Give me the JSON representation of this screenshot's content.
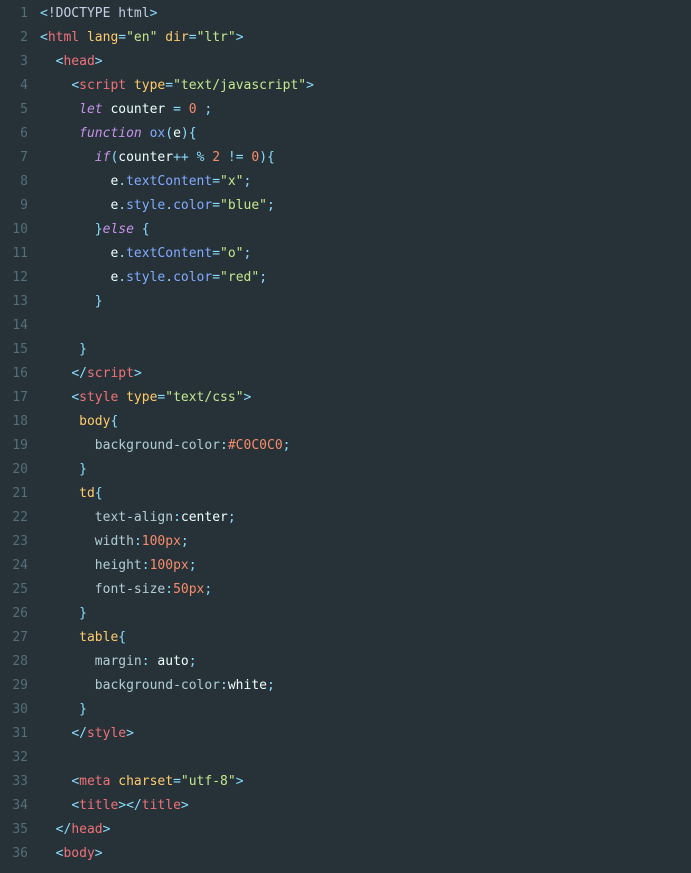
{
  "lines": [
    {
      "n": 1,
      "tokens": [
        [
          "<",
          "punc"
        ],
        [
          "!DOCTYPE html",
          "plain"
        ],
        [
          ">",
          "punc"
        ]
      ]
    },
    {
      "n": 2,
      "tokens": [
        [
          "<",
          "punc"
        ],
        [
          "html",
          "tag"
        ],
        [
          " ",
          "plain"
        ],
        [
          "lang",
          "attr"
        ],
        [
          "=",
          "op"
        ],
        [
          "\"en\"",
          "str"
        ],
        [
          " ",
          "plain"
        ],
        [
          "dir",
          "attr"
        ],
        [
          "=",
          "op"
        ],
        [
          "\"ltr\"",
          "str"
        ],
        [
          ">",
          "punc"
        ]
      ]
    },
    {
      "n": 3,
      "tokens": [
        [
          "  ",
          "plain"
        ],
        [
          "<",
          "punc"
        ],
        [
          "head",
          "tag"
        ],
        [
          ">",
          "punc"
        ]
      ]
    },
    {
      "n": 4,
      "tokens": [
        [
          "    ",
          "plain"
        ],
        [
          "<",
          "punc"
        ],
        [
          "script",
          "tag"
        ],
        [
          " ",
          "plain"
        ],
        [
          "type",
          "attr"
        ],
        [
          "=",
          "op"
        ],
        [
          "\"text/javascript\"",
          "str"
        ],
        [
          ">",
          "punc"
        ]
      ]
    },
    {
      "n": 5,
      "tokens": [
        [
          "     ",
          "plain"
        ],
        [
          "let",
          "keyword"
        ],
        [
          " ",
          "plain"
        ],
        [
          "counter",
          "var"
        ],
        [
          " ",
          "plain"
        ],
        [
          "=",
          "op"
        ],
        [
          " ",
          "plain"
        ],
        [
          "0",
          "num"
        ],
        [
          " ",
          "plain"
        ],
        [
          ";",
          "punc"
        ]
      ]
    },
    {
      "n": 6,
      "tokens": [
        [
          "     ",
          "plain"
        ],
        [
          "function",
          "keyword"
        ],
        [
          " ",
          "plain"
        ],
        [
          "ox",
          "prop"
        ],
        [
          "(",
          "punc"
        ],
        [
          "e",
          "var"
        ],
        [
          ")",
          "punc"
        ],
        [
          "{",
          "punc"
        ]
      ]
    },
    {
      "n": 7,
      "tokens": [
        [
          "       ",
          "plain"
        ],
        [
          "if",
          "keyword"
        ],
        [
          "(",
          "punc"
        ],
        [
          "counter",
          "var"
        ],
        [
          "++",
          "op"
        ],
        [
          " ",
          "plain"
        ],
        [
          "%",
          "op"
        ],
        [
          " ",
          "plain"
        ],
        [
          "2",
          "num"
        ],
        [
          " ",
          "plain"
        ],
        [
          "!=",
          "op"
        ],
        [
          " ",
          "plain"
        ],
        [
          "0",
          "num"
        ],
        [
          ")",
          "punc"
        ],
        [
          "{",
          "punc"
        ]
      ]
    },
    {
      "n": 8,
      "tokens": [
        [
          "         ",
          "plain"
        ],
        [
          "e",
          "var"
        ],
        [
          ".",
          "punc"
        ],
        [
          "textContent",
          "prop"
        ],
        [
          "=",
          "op"
        ],
        [
          "\"x\"",
          "str"
        ],
        [
          ";",
          "punc"
        ]
      ]
    },
    {
      "n": 9,
      "tokens": [
        [
          "         ",
          "plain"
        ],
        [
          "e",
          "var"
        ],
        [
          ".",
          "punc"
        ],
        [
          "style",
          "prop"
        ],
        [
          ".",
          "punc"
        ],
        [
          "color",
          "prop"
        ],
        [
          "=",
          "op"
        ],
        [
          "\"blue\"",
          "str"
        ],
        [
          ";",
          "punc"
        ]
      ]
    },
    {
      "n": 10,
      "tokens": [
        [
          "       ",
          "plain"
        ],
        [
          "}",
          "punc"
        ],
        [
          "else",
          "keyword"
        ],
        [
          " ",
          "plain"
        ],
        [
          "{",
          "punc"
        ]
      ]
    },
    {
      "n": 11,
      "tokens": [
        [
          "         ",
          "plain"
        ],
        [
          "e",
          "var"
        ],
        [
          ".",
          "punc"
        ],
        [
          "textContent",
          "prop"
        ],
        [
          "=",
          "op"
        ],
        [
          "\"o\"",
          "str"
        ],
        [
          ";",
          "punc"
        ]
      ]
    },
    {
      "n": 12,
      "tokens": [
        [
          "         ",
          "plain"
        ],
        [
          "e",
          "var"
        ],
        [
          ".",
          "punc"
        ],
        [
          "style",
          "prop"
        ],
        [
          ".",
          "punc"
        ],
        [
          "color",
          "prop"
        ],
        [
          "=",
          "op"
        ],
        [
          "\"red\"",
          "str"
        ],
        [
          ";",
          "punc"
        ]
      ]
    },
    {
      "n": 13,
      "tokens": [
        [
          "       ",
          "plain"
        ],
        [
          "}",
          "punc"
        ]
      ]
    },
    {
      "n": 14,
      "tokens": [
        [
          "",
          "plain"
        ]
      ]
    },
    {
      "n": 15,
      "tokens": [
        [
          "     ",
          "plain"
        ],
        [
          "}",
          "punc"
        ]
      ]
    },
    {
      "n": 16,
      "tokens": [
        [
          "    ",
          "plain"
        ],
        [
          "</",
          "punc"
        ],
        [
          "script",
          "tag"
        ],
        [
          ">",
          "punc"
        ]
      ]
    },
    {
      "n": 17,
      "tokens": [
        [
          "    ",
          "plain"
        ],
        [
          "<",
          "punc"
        ],
        [
          "style",
          "tag"
        ],
        [
          " ",
          "plain"
        ],
        [
          "type",
          "attr"
        ],
        [
          "=",
          "op"
        ],
        [
          "\"text/css\"",
          "str"
        ],
        [
          ">",
          "punc"
        ]
      ]
    },
    {
      "n": 18,
      "tokens": [
        [
          "     ",
          "plain"
        ],
        [
          "body",
          "csssel"
        ],
        [
          "{",
          "punc"
        ]
      ]
    },
    {
      "n": 19,
      "tokens": [
        [
          "       ",
          "plain"
        ],
        [
          "background-color",
          "cssprop"
        ],
        [
          ":",
          "punc"
        ],
        [
          "#C0C0C0",
          "num"
        ],
        [
          ";",
          "punc"
        ]
      ]
    },
    {
      "n": 20,
      "tokens": [
        [
          "     ",
          "plain"
        ],
        [
          "}",
          "punc"
        ]
      ]
    },
    {
      "n": 21,
      "tokens": [
        [
          "     ",
          "plain"
        ],
        [
          "td",
          "csssel"
        ],
        [
          "{",
          "punc"
        ]
      ]
    },
    {
      "n": 22,
      "tokens": [
        [
          "       ",
          "plain"
        ],
        [
          "text-align",
          "cssprop"
        ],
        [
          ":",
          "punc"
        ],
        [
          "center",
          "white"
        ],
        [
          ";",
          "punc"
        ]
      ]
    },
    {
      "n": 23,
      "tokens": [
        [
          "       ",
          "plain"
        ],
        [
          "width",
          "cssprop"
        ],
        [
          ":",
          "punc"
        ],
        [
          "100px",
          "num"
        ],
        [
          ";",
          "punc"
        ]
      ]
    },
    {
      "n": 24,
      "tokens": [
        [
          "       ",
          "plain"
        ],
        [
          "height",
          "cssprop"
        ],
        [
          ":",
          "punc"
        ],
        [
          "100px",
          "num"
        ],
        [
          ";",
          "punc"
        ]
      ]
    },
    {
      "n": 25,
      "tokens": [
        [
          "       ",
          "plain"
        ],
        [
          "font-size",
          "cssprop"
        ],
        [
          ":",
          "punc"
        ],
        [
          "50px",
          "num"
        ],
        [
          ";",
          "punc"
        ]
      ]
    },
    {
      "n": 26,
      "tokens": [
        [
          "     ",
          "plain"
        ],
        [
          "}",
          "punc"
        ]
      ]
    },
    {
      "n": 27,
      "tokens": [
        [
          "     ",
          "plain"
        ],
        [
          "table",
          "csssel"
        ],
        [
          "{",
          "punc"
        ]
      ]
    },
    {
      "n": 28,
      "tokens": [
        [
          "       ",
          "plain"
        ],
        [
          "margin",
          "cssprop"
        ],
        [
          ":",
          "punc"
        ],
        [
          " auto",
          "white"
        ],
        [
          ";",
          "punc"
        ]
      ]
    },
    {
      "n": 29,
      "tokens": [
        [
          "       ",
          "plain"
        ],
        [
          "background-color",
          "cssprop"
        ],
        [
          ":",
          "punc"
        ],
        [
          "white",
          "white"
        ],
        [
          ";",
          "punc"
        ]
      ]
    },
    {
      "n": 30,
      "tokens": [
        [
          "     ",
          "plain"
        ],
        [
          "}",
          "punc"
        ]
      ]
    },
    {
      "n": 31,
      "tokens": [
        [
          "    ",
          "plain"
        ],
        [
          "</",
          "punc"
        ],
        [
          "style",
          "tag"
        ],
        [
          ">",
          "punc"
        ]
      ]
    },
    {
      "n": 32,
      "tokens": [
        [
          "",
          "plain"
        ]
      ]
    },
    {
      "n": 33,
      "tokens": [
        [
          "    ",
          "plain"
        ],
        [
          "<",
          "punc"
        ],
        [
          "meta",
          "tag"
        ],
        [
          " ",
          "plain"
        ],
        [
          "charset",
          "attr"
        ],
        [
          "=",
          "op"
        ],
        [
          "\"utf-8\"",
          "str"
        ],
        [
          ">",
          "punc"
        ]
      ]
    },
    {
      "n": 34,
      "tokens": [
        [
          "    ",
          "plain"
        ],
        [
          "<",
          "punc"
        ],
        [
          "title",
          "tag"
        ],
        [
          ">",
          "punc"
        ],
        [
          "</",
          "punc"
        ],
        [
          "title",
          "tag"
        ],
        [
          ">",
          "punc"
        ]
      ]
    },
    {
      "n": 35,
      "tokens": [
        [
          "  ",
          "plain"
        ],
        [
          "</",
          "punc"
        ],
        [
          "head",
          "tag"
        ],
        [
          ">",
          "punc"
        ]
      ]
    },
    {
      "n": 36,
      "tokens": [
        [
          "  ",
          "plain"
        ],
        [
          "<",
          "punc"
        ],
        [
          "body",
          "tag"
        ],
        [
          ">",
          "punc"
        ]
      ]
    }
  ]
}
